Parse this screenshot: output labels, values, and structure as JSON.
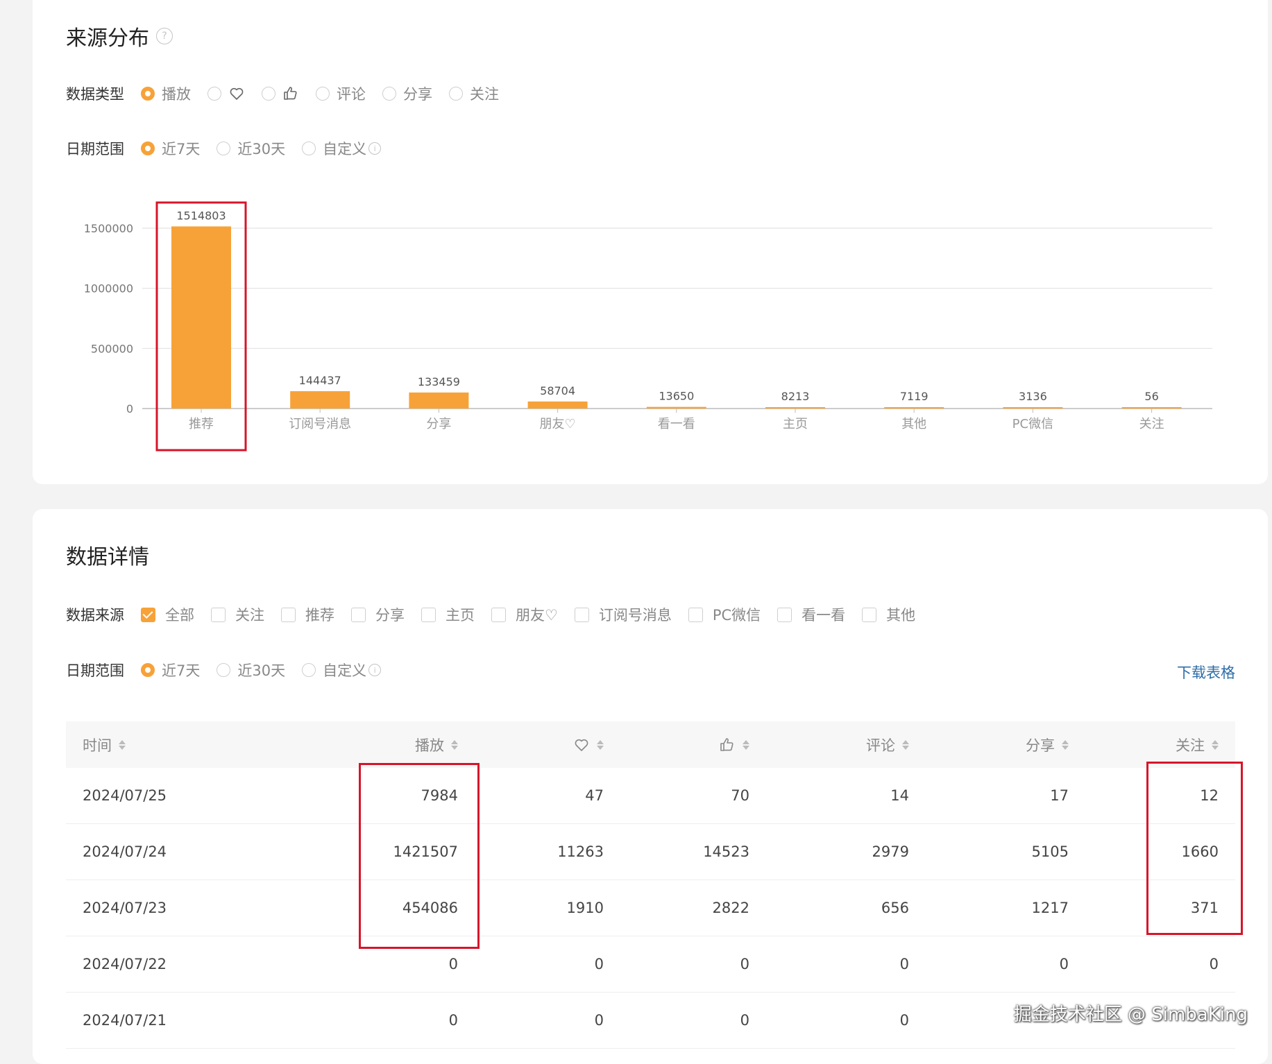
{
  "source_section": {
    "title": "来源分布",
    "help_icon": "question-circle-icon",
    "data_type": {
      "label": "数据类型",
      "options": [
        {
          "label": "播放",
          "icon": "",
          "checked": true
        },
        {
          "label": "",
          "icon": "heart-icon",
          "checked": false
        },
        {
          "label": "",
          "icon": "thumbs-up-icon",
          "checked": false
        },
        {
          "label": "评论",
          "icon": "",
          "checked": false
        },
        {
          "label": "分享",
          "icon": "",
          "checked": false
        },
        {
          "label": "关注",
          "icon": "",
          "checked": false
        }
      ]
    },
    "date_range": {
      "label": "日期范围",
      "options": [
        {
          "label": "近7天",
          "checked": true
        },
        {
          "label": "近30天",
          "checked": false
        },
        {
          "label": "自定义",
          "checked": false,
          "info": true
        }
      ]
    }
  },
  "chart_data": {
    "type": "bar",
    "categories": [
      "推荐",
      "订阅号消息",
      "分享",
      "朋友♡",
      "看一看",
      "主页",
      "其他",
      "PC微信",
      "关注"
    ],
    "values": [
      1514803,
      144437,
      133459,
      58704,
      13650,
      8213,
      7119,
      3136,
      56
    ],
    "yticks": [
      0,
      500000,
      1000000,
      1500000
    ],
    "ylim": [
      0,
      1500000
    ],
    "bar_color": "#f7a238",
    "grid": true,
    "highlight_category": "推荐"
  },
  "detail_section": {
    "title": "数据详情",
    "source_filter": {
      "label": "数据来源",
      "options": [
        {
          "label": "全部",
          "checked": true
        },
        {
          "label": "关注",
          "checked": false
        },
        {
          "label": "推荐",
          "checked": false
        },
        {
          "label": "分享",
          "checked": false
        },
        {
          "label": "主页",
          "checked": false
        },
        {
          "label": "朋友♡",
          "checked": false
        },
        {
          "label": "订阅号消息",
          "checked": false
        },
        {
          "label": "PC微信",
          "checked": false
        },
        {
          "label": "看一看",
          "checked": false
        },
        {
          "label": "其他",
          "checked": false
        }
      ]
    },
    "date_range": {
      "label": "日期范围",
      "options": [
        {
          "label": "近7天",
          "checked": true
        },
        {
          "label": "近30天",
          "checked": false
        },
        {
          "label": "自定义",
          "checked": false,
          "info": true
        }
      ]
    },
    "download_label": "下载表格",
    "table": {
      "columns": [
        {
          "label": "时间",
          "icon": ""
        },
        {
          "label": "播放",
          "icon": ""
        },
        {
          "label": "",
          "icon": "heart-icon"
        },
        {
          "label": "",
          "icon": "thumbs-up-icon"
        },
        {
          "label": "评论",
          "icon": ""
        },
        {
          "label": "分享",
          "icon": ""
        },
        {
          "label": "关注",
          "icon": ""
        }
      ],
      "rows": [
        [
          "2024/07/25",
          "7984",
          "47",
          "70",
          "14",
          "17",
          "12"
        ],
        [
          "2024/07/24",
          "1421507",
          "11263",
          "14523",
          "2979",
          "5105",
          "1660"
        ],
        [
          "2024/07/23",
          "454086",
          "1910",
          "2822",
          "656",
          "1217",
          "371"
        ],
        [
          "2024/07/22",
          "0",
          "0",
          "0",
          "0",
          "0",
          "0"
        ],
        [
          "2024/07/21",
          "0",
          "0",
          "0",
          "0",
          "",
          ""
        ]
      ]
    }
  },
  "watermark": "掘金技术社区 @ SimbaKing",
  "colors": {
    "accent": "#f7a238",
    "highlight": "#d7142a",
    "link": "#2d6ea8"
  }
}
